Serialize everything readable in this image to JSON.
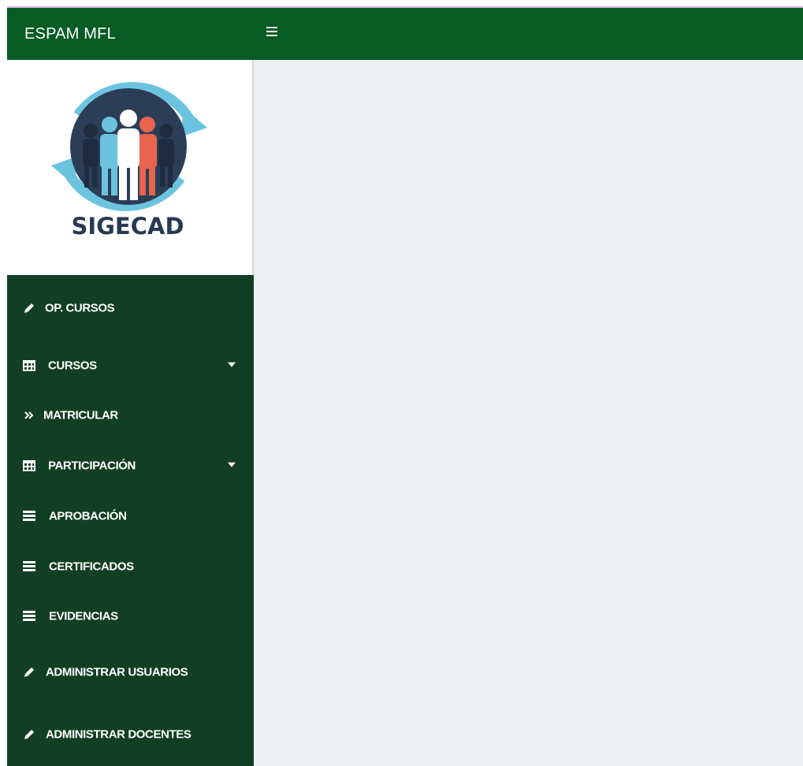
{
  "navbar": {
    "brand": "ESPAM MFL",
    "menu_icon": "hamburger-icon",
    "color": "#065c24"
  },
  "logo": {
    "text": "SIGECAD"
  },
  "sidebar": {
    "color": "#123f24",
    "items": [
      {
        "label": "OP. CURSOS",
        "icon": "pencil-icon",
        "has_dropdown": false
      },
      {
        "label": "CURSOS",
        "icon": "table-icon",
        "has_dropdown": true
      },
      {
        "label": "MATRICULAR",
        "icon": "double-chevron-right-icon",
        "has_dropdown": false
      },
      {
        "label": "PARTICIPACIÓN",
        "icon": "table-icon",
        "has_dropdown": true
      },
      {
        "label": "APROBACIÓN",
        "icon": "list-icon",
        "has_dropdown": false
      },
      {
        "label": "CERTIFICADOS",
        "icon": "list-icon",
        "has_dropdown": false
      },
      {
        "label": "EVIDENCIAS",
        "icon": "list-icon",
        "has_dropdown": false
      },
      {
        "label": "ADMINISTRAR USUARIOS",
        "icon": "pencil-icon",
        "has_dropdown": false
      },
      {
        "label": "ADMINISTRAR DOCENTES",
        "icon": "pencil-icon",
        "has_dropdown": false
      }
    ]
  }
}
